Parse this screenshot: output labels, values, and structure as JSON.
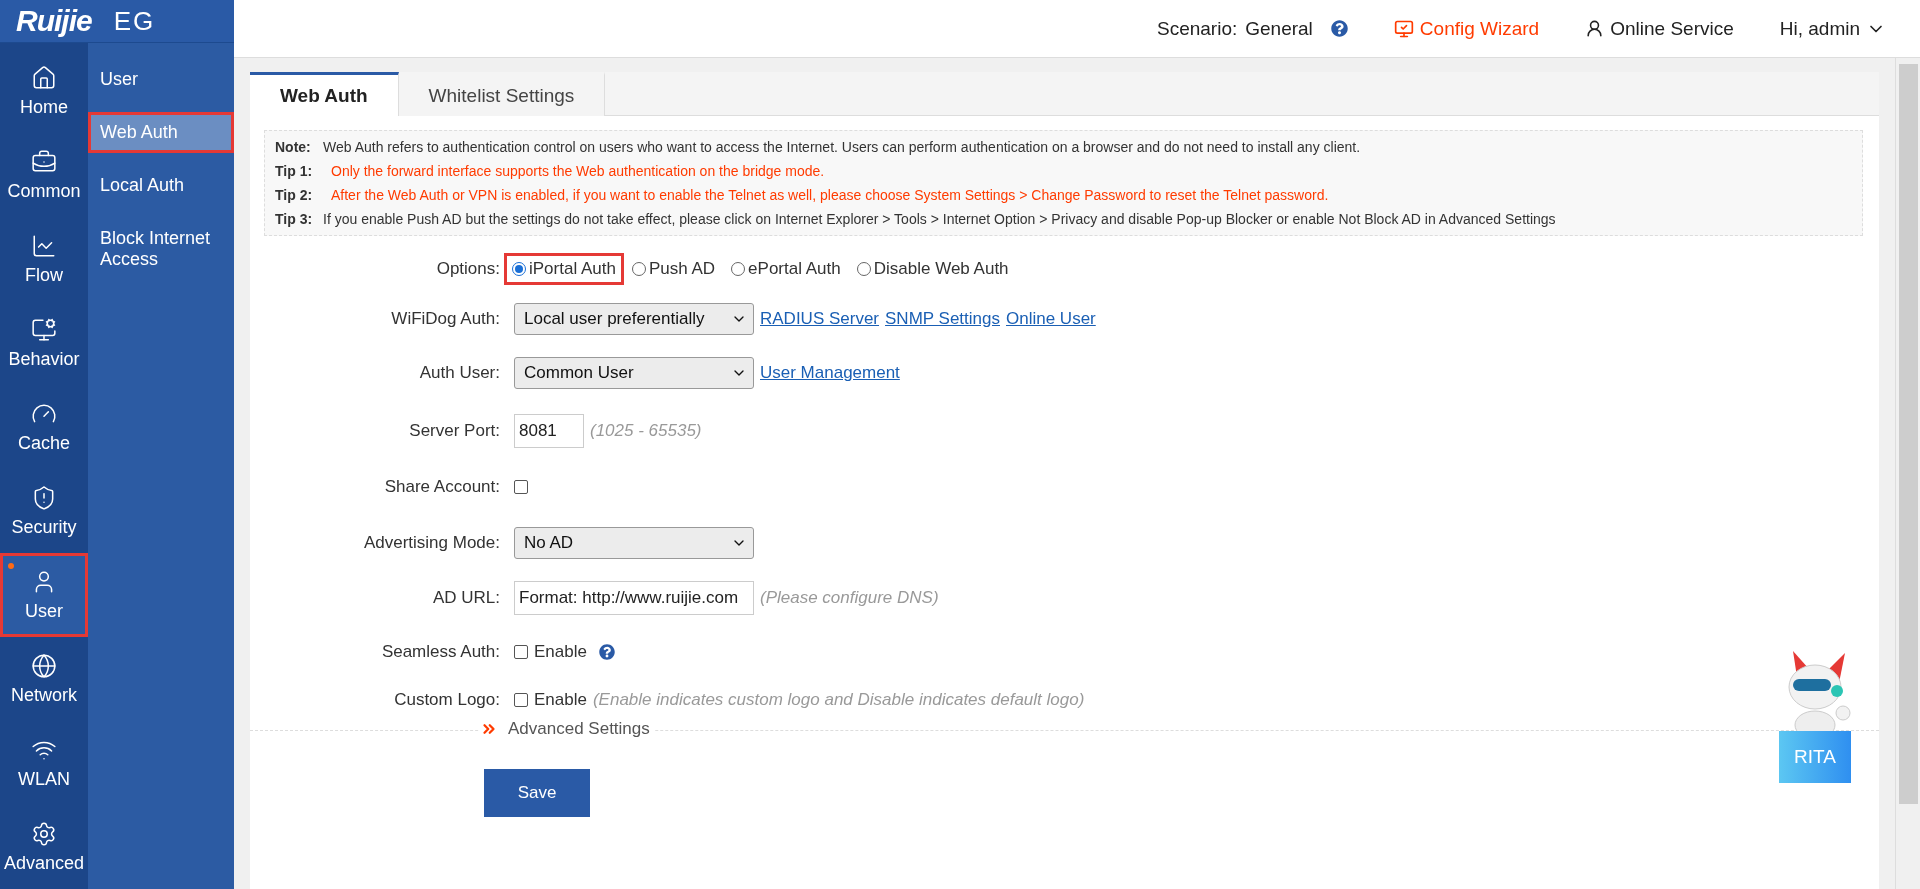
{
  "header": {
    "logo": "Ruijie",
    "product": "EG",
    "scenario_label": "Scenario:",
    "scenario": "General",
    "config_wizard": "Config Wizard",
    "online_service": "Online Service",
    "user_menu": "Hi, admin"
  },
  "nav": [
    {
      "label": "Home",
      "selected": false,
      "highlighted": false,
      "notice": false
    },
    {
      "label": "Common",
      "selected": false,
      "highlighted": false,
      "notice": false
    },
    {
      "label": "Flow",
      "selected": false,
      "highlighted": false,
      "notice": false
    },
    {
      "label": "Behavior",
      "selected": false,
      "highlighted": false,
      "notice": false
    },
    {
      "label": "Cache",
      "selected": false,
      "highlighted": false,
      "notice": false
    },
    {
      "label": "Security",
      "selected": false,
      "highlighted": false,
      "notice": false
    },
    {
      "label": "User",
      "selected": true,
      "highlighted": true,
      "notice": true
    },
    {
      "label": "Network",
      "selected": false,
      "highlighted": false,
      "notice": false
    },
    {
      "label": "WLAN",
      "selected": false,
      "highlighted": false,
      "notice": false
    },
    {
      "label": "Advanced",
      "selected": false,
      "highlighted": false,
      "notice": false
    }
  ],
  "submenu": [
    {
      "label": "User",
      "selected": false,
      "highlighted": false
    },
    {
      "label": "Web Auth",
      "selected": true,
      "highlighted": true
    },
    {
      "label": "Local Auth",
      "selected": false,
      "highlighted": false
    },
    {
      "label": "Block Internet Access",
      "selected": false,
      "highlighted": false
    }
  ],
  "tabs": [
    {
      "label": "Web Auth",
      "selected": true
    },
    {
      "label": "Whitelist Settings",
      "selected": false
    }
  ],
  "notes": [
    {
      "label": "Note:",
      "text": "Web Auth refers to authentication control on users who want to access the Internet. Users can perform authentication on a browser and do not need to install any client.",
      "kind": "info"
    },
    {
      "label": "Tip 1:",
      "text": "Only the forward interface supports the Web authentication on the bridge mode.",
      "kind": "warning"
    },
    {
      "label": "Tip 2:",
      "text": "After the Web Auth or VPN is enabled, if you want to enable the Telnet as well, please choose System Settings > Change Password to reset the Telnet password.",
      "kind": "warning"
    },
    {
      "label": "Tip 3:",
      "text": "If you enable Push AD but the settings do not take effect, please click on Internet Explorer > Tools > Internet Option > Privacy and disable Pop-up Blocker or enable Not Block AD in Advanced Settings",
      "kind": "info"
    }
  ],
  "options": {
    "label": "Options:",
    "choices": [
      {
        "label": "iPortal Auth",
        "selected": true,
        "highlighted": true
      },
      {
        "label": "Push AD",
        "selected": false,
        "highlighted": false
      },
      {
        "label": "ePortal Auth",
        "selected": false,
        "highlighted": false
      },
      {
        "label": "Disable Web Auth",
        "selected": false,
        "highlighted": false
      }
    ]
  },
  "rows": [
    {
      "kind": "select",
      "label": "WiFiDog Auth:",
      "value": "Local user preferentially",
      "links": [
        "RADIUS Server",
        "SNMP Settings",
        "Online User"
      ]
    },
    {
      "kind": "select",
      "label": "Auth User:",
      "value": "Common User",
      "links": [
        "User Management"
      ]
    },
    {
      "kind": "input",
      "label": "Server Port:",
      "value": "8081",
      "hint": "(1025 - 65535)"
    },
    {
      "kind": "checkbox",
      "label": "Share Account:",
      "checked": false
    },
    {
      "kind": "select",
      "label": "Advertising Mode:",
      "value": "No AD"
    },
    {
      "kind": "input",
      "label": "AD URL:",
      "placeholder": "Format: http://www.ruijie.com",
      "hint": "(Please configure DNS)"
    },
    {
      "kind": "checkbox",
      "label": "Seamless Auth:",
      "checked": false,
      "text": "Enable",
      "help": true
    },
    {
      "kind": "checkbox",
      "label": "Custom Logo:",
      "checked": false,
      "text": "Enable",
      "hint": "(Enable indicates custom logo and Disable indicates default logo)"
    }
  ],
  "advanced": "Advanced Settings",
  "save": "Save",
  "assistant": {
    "label": "RITA"
  }
}
